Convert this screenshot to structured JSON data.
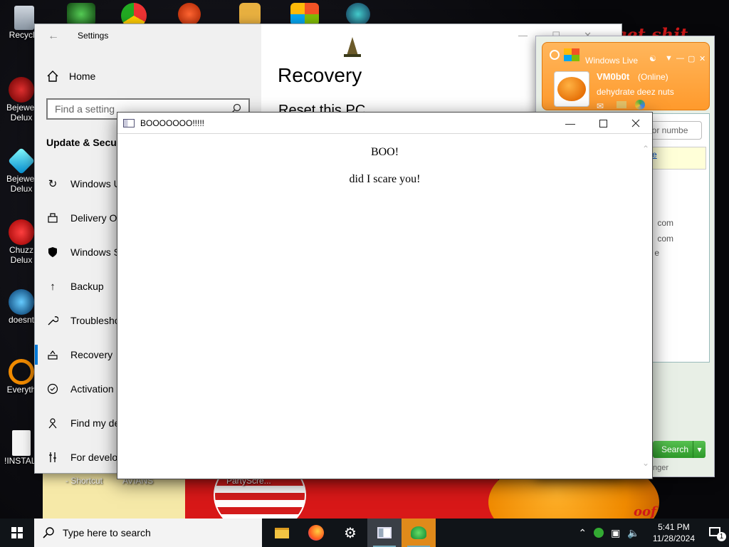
{
  "desktop": {
    "icons": [
      {
        "label": "Recycle"
      },
      {
        "label": "Bejewel\nDelux"
      },
      {
        "label": "Bejewel\nDelux"
      },
      {
        "label": "Chuzz\nDelux"
      },
      {
        "label": "doesnt"
      },
      {
        "label": "Everyth"
      },
      {
        "label": "!INSTALL"
      }
    ],
    "labels": {
      "shortcut": "- Shortcut",
      "avians": "AVIANS",
      "party": "PartyScre..."
    },
    "wall_text": "e get shit"
  },
  "settings": {
    "title": "Settings",
    "home": "Home",
    "find_placeholder": "Find a setting",
    "section": "Update & Secur",
    "nav": [
      {
        "label": "Windows U",
        "icon": "refresh-icon"
      },
      {
        "label": "Delivery Op",
        "icon": "delivery-icon"
      },
      {
        "label": "Windows S",
        "icon": "shield-icon"
      },
      {
        "label": "Backup",
        "icon": "upload-icon"
      },
      {
        "label": "Troublesho",
        "icon": "wrench-icon"
      },
      {
        "label": "Recovery",
        "icon": "recovery-icon"
      },
      {
        "label": "Activation",
        "icon": "check-circle-icon"
      },
      {
        "label": "Find my de",
        "icon": "person-pin-icon"
      },
      {
        "label": "For develop",
        "icon": "tools-icon"
      }
    ],
    "page_title": "Recovery",
    "page_subtitle": "Reset this PC"
  },
  "messenger": {
    "brand": "Windows Live",
    "username": "VM0b0t",
    "status": "(Online)",
    "personal_message": "dehydrate deez nuts",
    "search_placeholder": "ct or numbe",
    "link": "the",
    "contact1": "com",
    "contact2": "com",
    "contact3": "e",
    "search_button": "Search",
    "footer": "nger"
  },
  "dialog": {
    "title": "BOOOOOOO!!!!!",
    "line1": "BOO!",
    "line2": "did I scare you!"
  },
  "taskbar": {
    "search_placeholder": "Type here to search",
    "time": "5:41 PM",
    "date": "11/28/2024",
    "notification_count": "1"
  }
}
